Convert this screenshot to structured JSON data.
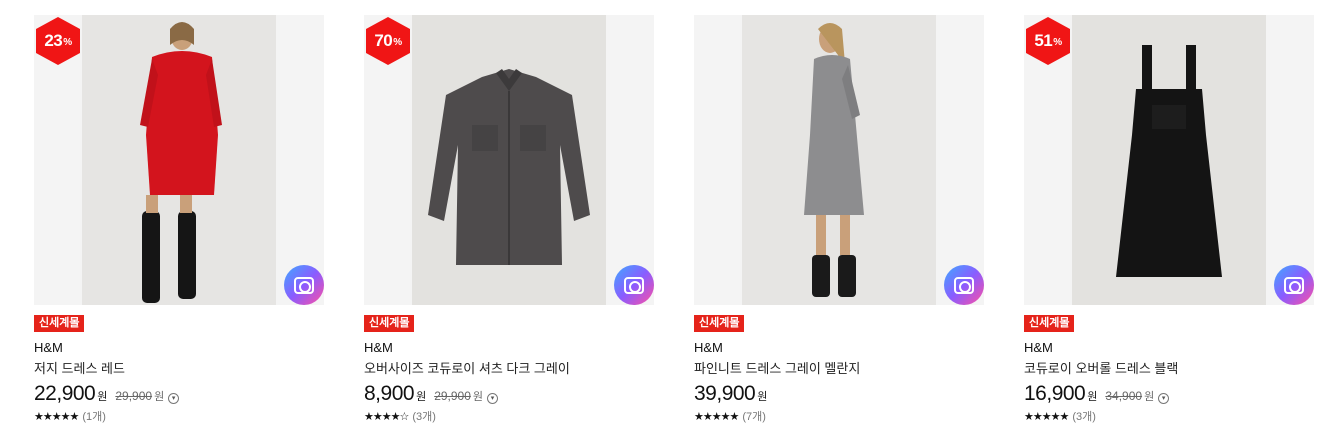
{
  "products": [
    {
      "discount": "23",
      "discount_unit": "%",
      "tag": "신세계몰",
      "brand": "H&M",
      "name": "저지 드레스 레드",
      "price": "22,900",
      "price_unit": "원",
      "original_price": "29,900",
      "original_unit": "원",
      "rating": 5,
      "rating_stars": "★★★★★",
      "reviews": "(1개)",
      "photo_color": "#d3141d"
    },
    {
      "discount": "70",
      "discount_unit": "%",
      "tag": "신세계몰",
      "brand": "H&M",
      "name": "오버사이즈 코듀로이 셔츠 다크 그레이",
      "price": "8,900",
      "price_unit": "원",
      "original_price": "29,900",
      "original_unit": "원",
      "rating": 4.5,
      "rating_stars": "★★★★☆",
      "reviews": "(3개)",
      "photo_color": "#4e4b4c"
    },
    {
      "discount": "",
      "discount_unit": "",
      "tag": "신세계몰",
      "brand": "H&M",
      "name": "파인니트 드레스 그레이 멜란지",
      "price": "39,900",
      "price_unit": "원",
      "original_price": "",
      "original_unit": "",
      "rating": 4.5,
      "rating_stars": "★★★★★",
      "reviews": "(7개)",
      "photo_color": "#8d8d8f"
    },
    {
      "discount": "51",
      "discount_unit": "%",
      "tag": "신세계몰",
      "brand": "H&M",
      "name": "코듀로이 오버롤 드레스 블랙",
      "price": "16,900",
      "price_unit": "원",
      "original_price": "34,900",
      "original_unit": "원",
      "rating": 5,
      "rating_stars": "★★★★★",
      "reviews": "(3개)",
      "photo_color": "#141414"
    }
  ],
  "icons": {
    "camera": "camera-search-icon",
    "info": "info-icon"
  },
  "colors": {
    "sale_badge": "#f01515",
    "tag_bg": "#e5231a"
  }
}
